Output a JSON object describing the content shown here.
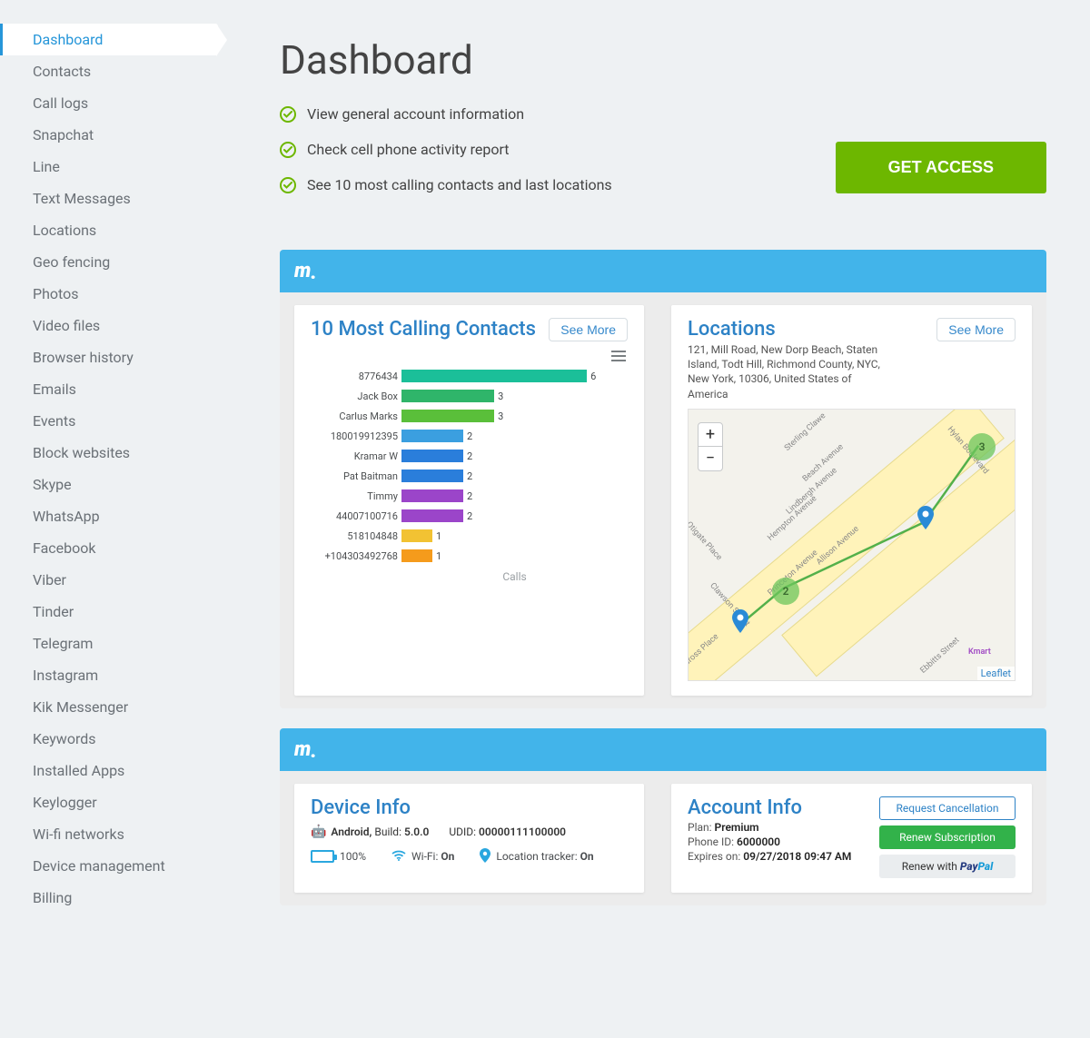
{
  "sidebar": {
    "items": [
      "Dashboard",
      "Contacts",
      "Call logs",
      "Snapchat",
      "Line",
      "Text Messages",
      "Locations",
      "Geo fencing",
      "Photos",
      "Video files",
      "Browser history",
      "Emails",
      "Events",
      "Block websites",
      "Skype",
      "WhatsApp",
      "Facebook",
      "Viber",
      "Tinder",
      "Telegram",
      "Instagram",
      "Kik Messenger",
      "Keywords",
      "Installed Apps",
      "Keylogger",
      "Wi-fi networks",
      "Device management",
      "Billing"
    ],
    "active": 0
  },
  "page": {
    "title": "Dashboard",
    "features": [
      "View general account information",
      "Check cell phone activity report",
      "See 10 most calling contacts and last locations"
    ],
    "get_access": "GET ACCESS"
  },
  "common": {
    "see_more": "See More",
    "leaflet": "Leaflet"
  },
  "contacts_card": {
    "title": "10 Most Calling Contacts",
    "footer": "Calls"
  },
  "chart_data": {
    "type": "bar",
    "orientation": "horizontal",
    "title": "10 Most Calling Contacts",
    "xlabel": "Calls",
    "ylabel": "",
    "xlim": [
      0,
      6
    ],
    "categories": [
      "8776434",
      "Jack Box",
      "Carlus Marks",
      "180019912395",
      "Kramar W",
      "Pat Baitman",
      "Timmy",
      "44007100716",
      "518104848",
      "+104303492768"
    ],
    "values": [
      6,
      3,
      3,
      2,
      2,
      2,
      2,
      2,
      1,
      1
    ],
    "colors": [
      "#1bbf99",
      "#2fb56a",
      "#5abf3a",
      "#3b9fe0",
      "#2a7edb",
      "#2a7edb",
      "#9b45c9",
      "#9b45c9",
      "#f2c233",
      "#f59b1c"
    ]
  },
  "locations_card": {
    "title": "Locations",
    "address": "121, Mill Road, New Dorp Beach, Staten Island, Todt Hill, Richmond County, NYC, New York, 10306, United States of America",
    "streets": [
      "Sterling Clawe",
      "Hylan Boulevard",
      "Beach Avenue",
      "Lindbergh Avenue",
      "Hempton Avenue",
      "Allison Avenue",
      "Princeton Avenue",
      "Clawson Street",
      "Gross Place",
      "Ebbitts Street",
      "Kmart",
      "Otigate Place"
    ],
    "clusters": [
      "2",
      "3"
    ]
  },
  "device_card": {
    "title": "Device Info",
    "os": "Android,",
    "build_label": "Build:",
    "build": "5.0.0",
    "udid_label": "UDID:",
    "udid": "00000111100000",
    "battery": "100%",
    "wifi_label": "Wi-Fi:",
    "wifi": "On",
    "tracker_label": "Location tracker:",
    "tracker": "On"
  },
  "account_card": {
    "title": "Account Info",
    "plan_label": "Plan:",
    "plan": "Premium",
    "phoneid_label": "Phone ID:",
    "phoneid": "6000000",
    "expires_label": "Expires on:",
    "expires": "09/27/2018 09:47 AM",
    "btn_cancel": "Request Cancellation",
    "btn_renew": "Renew Subscription",
    "btn_pp_prefix": "Renew with "
  }
}
